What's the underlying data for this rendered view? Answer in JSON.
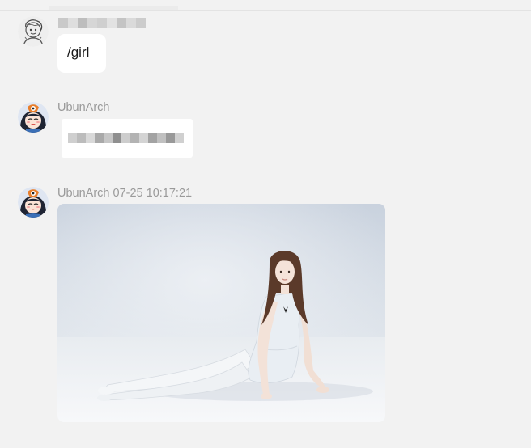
{
  "messages": [
    {
      "sender_name": "",
      "sender_hidden": true,
      "text": "/girl",
      "avatar_icon": "line-art-avatar"
    },
    {
      "sender_name": "UbunArch",
      "content": "redacted-pixelated-text",
      "avatar_icon": "anime-girl-penguin-hat-avatar"
    },
    {
      "sender_name": "UbunArch",
      "timestamp": "07-25 10:17:21",
      "attachment": "photo",
      "photo_subject": "woman in white dress reclining on white floor",
      "avatar_icon": "anime-girl-penguin-hat-avatar"
    }
  ],
  "colors": {
    "background": "#f2f2f2",
    "bubble": "#ffffff",
    "meta_text": "#9a9a9a",
    "message_text": "#1a1a1a"
  }
}
